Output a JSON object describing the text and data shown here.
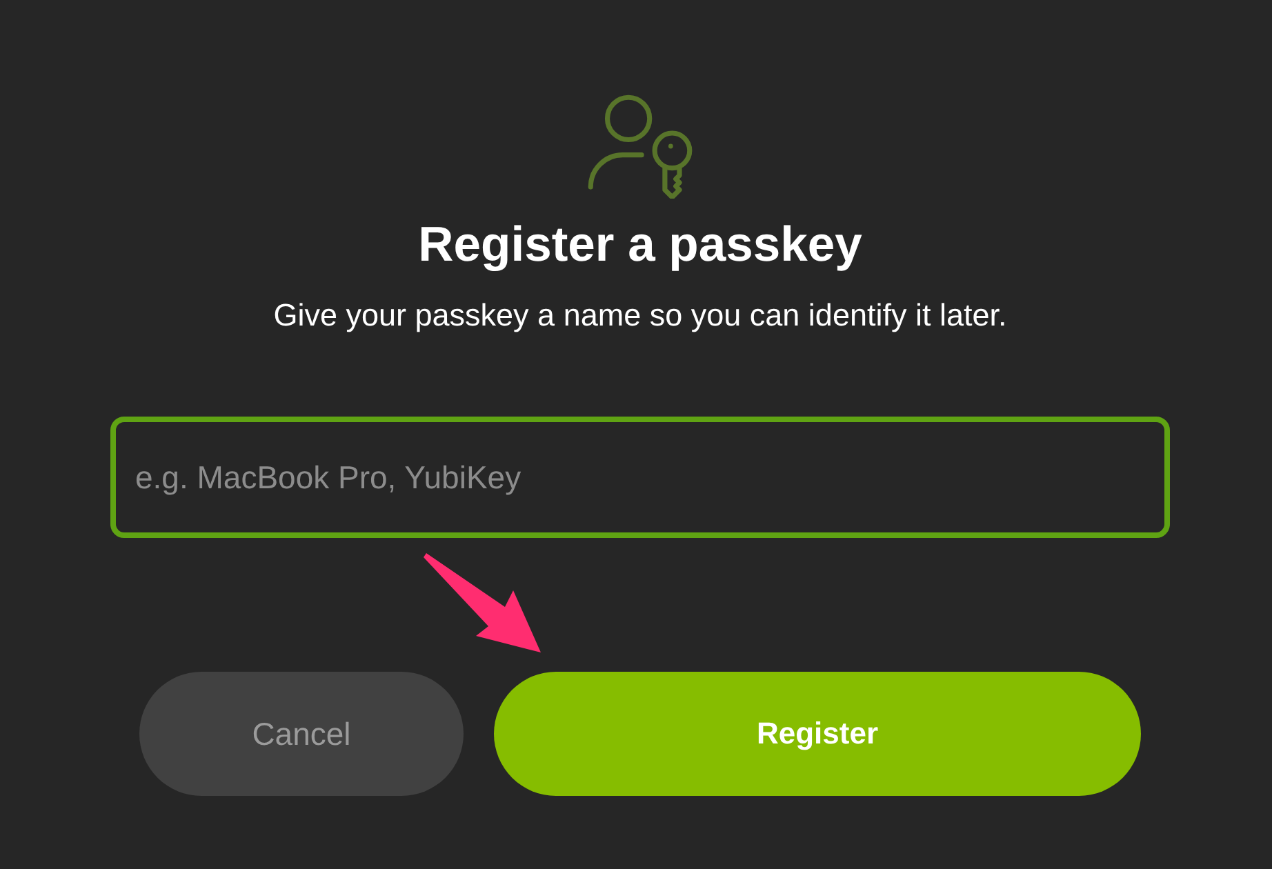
{
  "dialog": {
    "title": "Register a passkey",
    "subtitle": "Give your passkey a name so you can identify it later.",
    "name_field": {
      "placeholder": "e.g. MacBook Pro, YubiKey",
      "focused": true
    },
    "buttons": [
      {
        "label": "Cancel",
        "kind": "secondary"
      },
      {
        "label": "Register",
        "kind": "primary"
      }
    ]
  }
}
